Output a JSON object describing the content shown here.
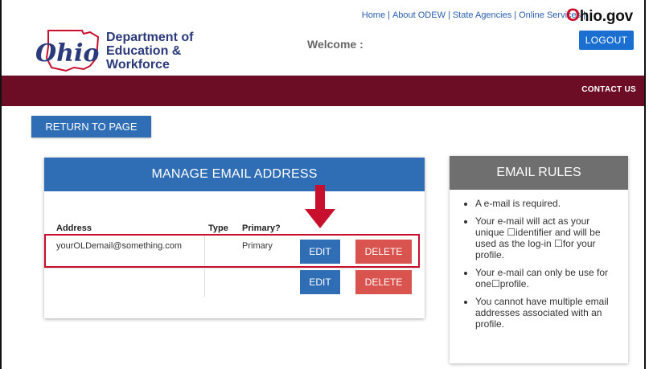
{
  "header": {
    "top_links": [
      "Home",
      "About ODEW",
      "State Agencies",
      "Online Services"
    ],
    "ohio_gov_o": "O",
    "ohio_gov_rest": "hio.gov",
    "dept_line1": "Department of",
    "dept_line2": "Education &",
    "dept_line3": "Workforce",
    "welcome": "Welcome :",
    "logout": "LOGOUT"
  },
  "nav": {
    "contact": "CONTACT US"
  },
  "return_button": "RETURN TO PAGE",
  "manage": {
    "title": "MANAGE EMAIL ADDRESS",
    "columns": [
      "Address",
      "Type",
      "Primary?"
    ],
    "rows": [
      {
        "address": "yourOLDemail@something.com",
        "type": "",
        "primary": "Primary",
        "edit": "EDIT",
        "delete": "DELETE"
      },
      {
        "address": "",
        "type": "",
        "primary": "",
        "edit": "EDIT",
        "delete": "DELETE"
      }
    ]
  },
  "rules": {
    "title": "EMAIL RULES",
    "items": [
      "A e-mail is required.",
      "Your e-mail will act as your unique ☐identifier and will be used as the log-in ☐for your profile.",
      "Your e-mail can only be use for one☐profile.",
      "You cannot have multiple email addresses associated with an profile."
    ]
  },
  "colors": {
    "brand_maroon": "#6d0c25",
    "primary_blue": "#2f6db5",
    "danger_red": "#d9534f",
    "highlight_red": "#c8102e"
  }
}
